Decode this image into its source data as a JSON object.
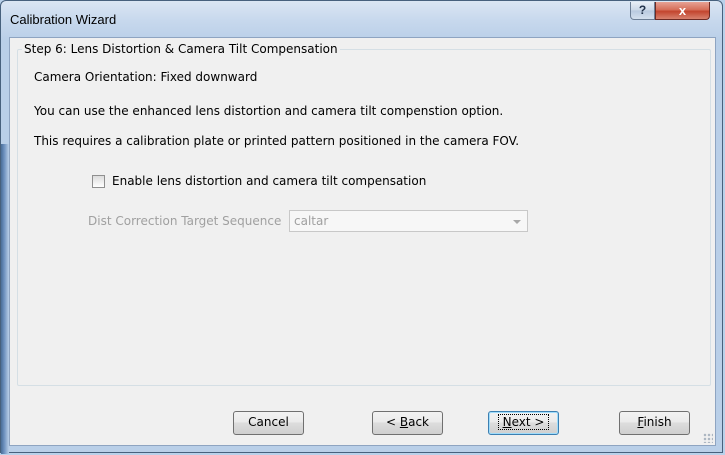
{
  "window": {
    "title": "Calibration Wizard",
    "help_label": "?",
    "close_label": "x"
  },
  "step": {
    "group_label": "Step 6: Lens Distortion & Camera Tilt Compensation",
    "orientation": "Camera Orientation: Fixed downward",
    "description_1": "You can use the enhanced lens distortion and camera tilt compenstion option.",
    "description_2": "This requires a calibration plate or printed pattern positioned in the camera FOV.",
    "checkbox_label": "Enable lens distortion and camera tilt compensation",
    "checkbox_checked": false,
    "sequence_label": "Dist Correction Target Sequence",
    "sequence_value": "caltar",
    "sequence_enabled": false
  },
  "buttons": {
    "cancel": "Cancel",
    "back_prefix": "< ",
    "back_mnemonic": "B",
    "back_rest": "ack",
    "next_mnemonic": "N",
    "next_rest": "ext >",
    "finish_mnemonic": "F",
    "finish_rest": "inish"
  },
  "colors": {
    "dialog_bg": "#f0f0f0",
    "frame": "#b9d1ea",
    "close_button": "#c3452e",
    "disabled_text": "#a0a0a0"
  }
}
